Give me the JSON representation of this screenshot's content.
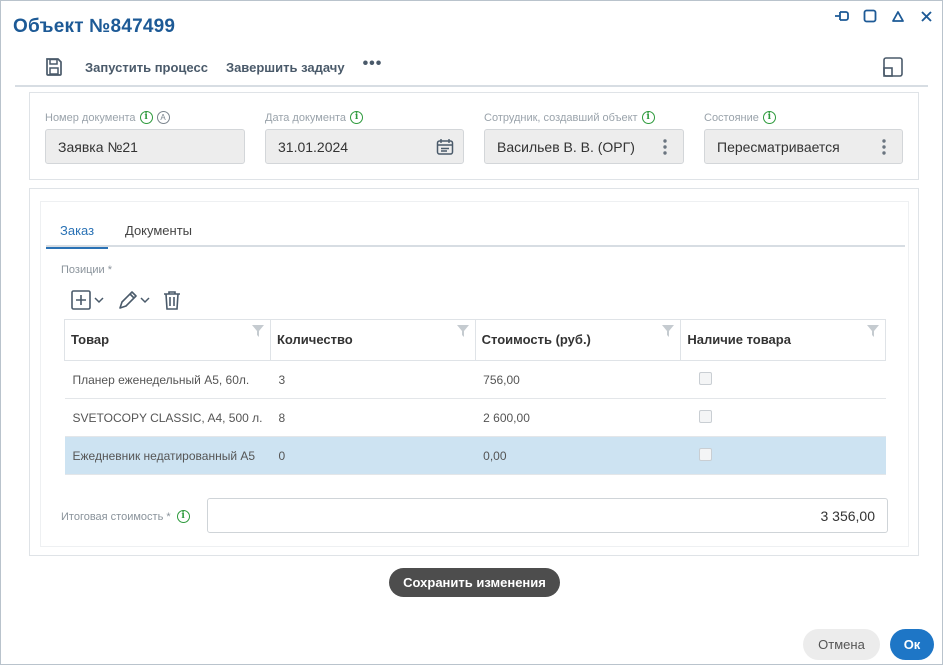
{
  "window": {
    "title": "Объект №847499",
    "controls": [
      "pin-icon",
      "maximize-icon",
      "collapse-icon",
      "close-icon"
    ]
  },
  "toolbar": {
    "save_icon": "floppy-disk-icon",
    "start_process": "Запустить процесс",
    "finish_task": "Завершить задачу",
    "more": "•••",
    "right_icon": "restore-window-icon"
  },
  "header": {
    "doc_number": {
      "label": "Номер документа",
      "value": "Заявка №21"
    },
    "doc_date": {
      "label": "Дата документа",
      "value": "31.01.2024"
    },
    "creator": {
      "label": "Сотрудник, создавший объект",
      "value": "Васильев В. В. (ОРГ)"
    },
    "state": {
      "label": "Состояние",
      "value": "Пересматривается"
    }
  },
  "tabs": [
    {
      "label": "Заказ",
      "active": true
    },
    {
      "label": "Документы",
      "active": false
    }
  ],
  "positions": {
    "label": "Позиции *",
    "columns": [
      "Товар",
      "Количество",
      "Стоимость (руб.)",
      "Наличие товара"
    ],
    "rows": [
      {
        "product": "Планер еженедельный А5, 60л.",
        "qty": "3",
        "cost": "756,00",
        "available": false,
        "selected": false
      },
      {
        "product": "SVETOCOPY CLASSIC, A4, 500 л.",
        "qty": "8",
        "cost": "2 600,00",
        "available": false,
        "selected": false
      },
      {
        "product": "Ежедневник недатированный А5",
        "qty": "0",
        "cost": "0,00",
        "available": false,
        "selected": true
      }
    ]
  },
  "total": {
    "label": "Итоговая стоимость *",
    "value": "3 356,00"
  },
  "buttons": {
    "save_changes": "Сохранить изменения",
    "cancel": "Отмена",
    "ok": "Ок"
  },
  "colors": {
    "title": "#1d5a96",
    "accent": "#2a72b5",
    "ok": "#1e76c6",
    "info": "#2d9a3c",
    "selected_row": "#cde3f2",
    "save_button": "#4d4d4d"
  }
}
